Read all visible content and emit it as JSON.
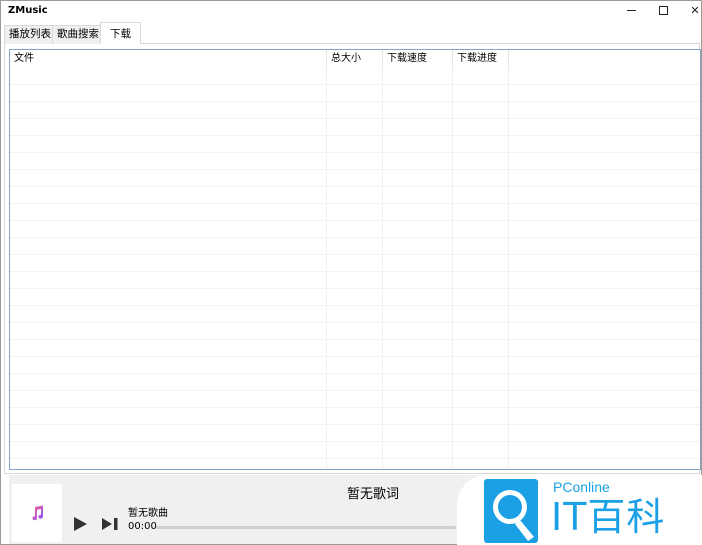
{
  "window": {
    "title": "ZMusic"
  },
  "tabs": [
    {
      "label": "播放列表"
    },
    {
      "label": "歌曲搜索"
    },
    {
      "label": "下载"
    }
  ],
  "download_list": {
    "columns": [
      "文件",
      "总大小",
      "下载速度",
      "下载进度"
    ],
    "rows": []
  },
  "player": {
    "lyrics": "暂无歌词",
    "song_name": "暂无歌曲",
    "current_time": "00:00",
    "progress": 0,
    "icons": {
      "album_art": "music-note-icon",
      "play": "play-icon",
      "next": "next-track-icon"
    }
  },
  "watermark": {
    "brand_small": "PConline",
    "brand_big": "IT百科",
    "color": "#1ba0e6"
  }
}
